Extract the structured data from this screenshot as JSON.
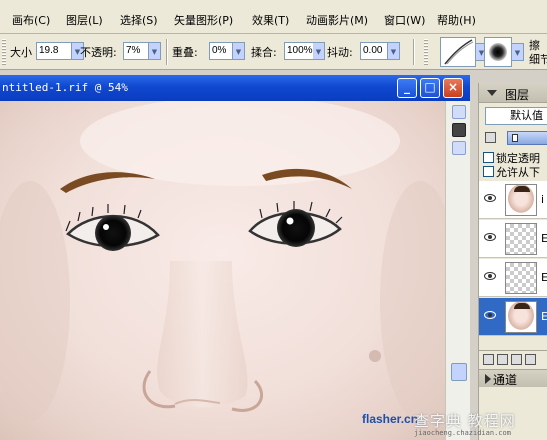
{
  "menubar": {
    "items": [
      "画布(C)",
      "图层(L)",
      "选择(S)",
      "矢量图形(P)",
      "效果(T)",
      "动画影片(M)",
      "窗口(W)",
      "帮助(H)"
    ]
  },
  "toolbar": {
    "size_label": "大小",
    "size_value": "19.8",
    "opacity_label": "不透明:",
    "opacity_value": "7%",
    "overlap_label": "重叠:",
    "overlap_value": "0%",
    "blend_label": "揉合:",
    "blend_value": "100%",
    "jitter_label": "抖动:",
    "jitter_value": "0.00",
    "right_label_1": "擦",
    "right_label_2": "细节"
  },
  "document": {
    "title": "ntitled-1.rif @ 54%"
  },
  "layers_panel": {
    "title": "图层",
    "preset": "默认值",
    "lock_transparency_label": "锁定透明",
    "allow_from_label": "允许从下",
    "layers": [
      {
        "thumb": "face",
        "label": "i",
        "selected": false
      },
      {
        "thumb": "checker",
        "label": "E",
        "selected": false
      },
      {
        "thumb": "checker",
        "label": "E",
        "selected": false
      },
      {
        "thumb": "face",
        "label": "E",
        "selected": true
      }
    ],
    "channels_label": "通道"
  },
  "watermark": {
    "flasher": "flasher.cn",
    "site_big": "查字典 教程网",
    "site_small": "jiaocheng.chazidian.com"
  },
  "colors": {
    "titlebar": "#0a3cc0",
    "selection": "#316ac5",
    "eyebrow": "#7a4a22"
  }
}
